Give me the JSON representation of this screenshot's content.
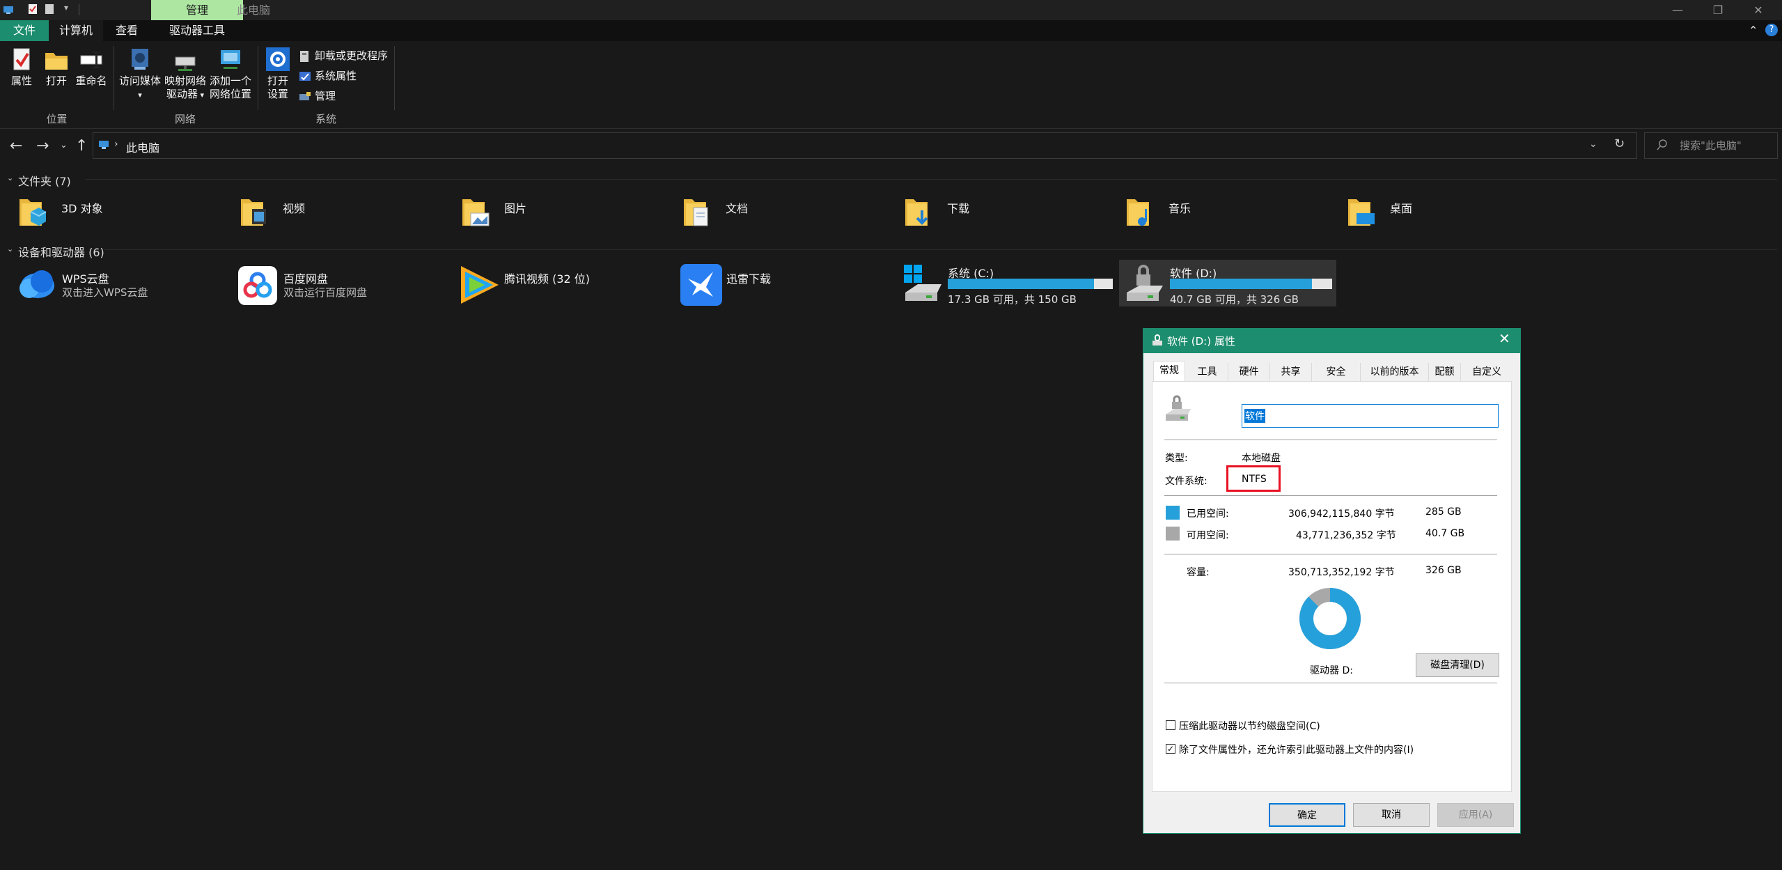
{
  "window": {
    "title": "此电脑",
    "context_tab": "管理"
  },
  "ribbon": {
    "tabs": [
      "文件",
      "计算机",
      "查看",
      "驱动器工具"
    ],
    "location": {
      "group_label": "位置",
      "properties": "属性",
      "open": "打开",
      "rename": "重命名"
    },
    "network": {
      "group_label": "网络",
      "access_media": "访问媒体",
      "map_drive_l1": "映射网络",
      "map_drive_l2": "驱动器",
      "add_location_l1": "添加一个",
      "add_location_l2": "网络位置"
    },
    "system": {
      "group_label": "系统",
      "open_settings_l1": "打开",
      "open_settings_l2": "设置",
      "uninstall": "卸载或更改程序",
      "system_properties": "系统属性",
      "manage": "管理"
    }
  },
  "nav": {
    "path": "此电脑",
    "search_placeholder": "搜索\"此电脑\""
  },
  "folders": {
    "header": "文件夹 (7)",
    "items": [
      "3D 对象",
      "视频",
      "图片",
      "文档",
      "下载",
      "音乐",
      "桌面"
    ]
  },
  "devices": {
    "header": "设备和驱动器 (6)",
    "items": [
      {
        "name": "WPS云盘",
        "sub": "双击进入WPS云盘"
      },
      {
        "name": "百度网盘",
        "sub": "双击运行百度网盘"
      },
      {
        "name": "腾讯视频 (32 位)",
        "sub": ""
      },
      {
        "name": "迅雷下载",
        "sub": ""
      },
      {
        "name": "系统 (C:)",
        "sub": "17.3 GB 可用，共 150 GB",
        "used_fraction": 0.885
      },
      {
        "name": "软件 (D:)",
        "sub": "40.7 GB 可用，共 326 GB",
        "used_fraction": 0.875
      }
    ]
  },
  "dialog": {
    "title": "软件 (D:) 属性",
    "tabs": [
      "常规",
      "工具",
      "硬件",
      "共享",
      "安全",
      "以前的版本",
      "配额",
      "自定义"
    ],
    "name_value": "软件",
    "type_label": "类型:",
    "type_value": "本地磁盘",
    "fs_label": "文件系统:",
    "fs_value": "NTFS",
    "used_label": "已用空间:",
    "used_bytes": "306,942,115,840 字节",
    "used_gb": "285 GB",
    "free_label": "可用空间:",
    "free_bytes": "43,771,236,352 字节",
    "free_gb": "40.7 GB",
    "capacity_label": "容量:",
    "capacity_bytes": "350,713,352,192 字节",
    "capacity_gb": "326 GB",
    "used_fraction": 0.875,
    "drive_label": "驱动器 D:",
    "cleanup_button": "磁盘清理(D)",
    "compress_label": "压缩此驱动器以节约磁盘空间(C)",
    "index_label": "除了文件属性外，还允许索引此驱动器上文件的内容(I)",
    "ok": "确定",
    "cancel": "取消",
    "apply": "应用(A)",
    "colors": {
      "used": "#26a0da",
      "free": "#a8a8a8",
      "accent": "#1c8d6e",
      "highlight": "#e81123"
    }
  }
}
